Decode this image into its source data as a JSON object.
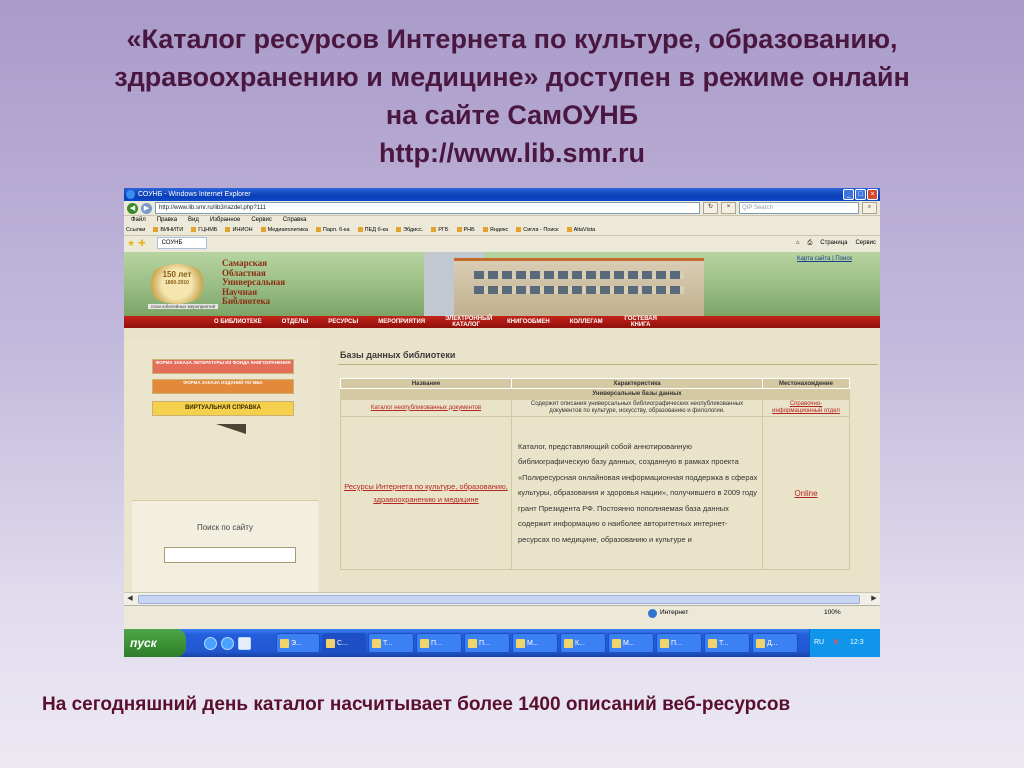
{
  "slide": {
    "title_line1": "«Каталог  ресурсов Интернета по культуре, образованию,",
    "title_line2": "здравоохранению и медицине» доступен в режиме онлайн",
    "title_line3": "на сайте СамОУНБ",
    "title_line4": "http://www.lib.smr.ru",
    "caption": "На сегодняшний день каталог насчитывает более 1400  описаний веб-ресурсов"
  },
  "browser": {
    "window_title": "СОУНБ - Windows Internet Explorer",
    "address": "http://www.lib.smr.ru/lib3/razdel.php?111",
    "search_placeholder": "QIP Search",
    "menu": [
      "Файл",
      "Правка",
      "Вид",
      "Избранное",
      "Сервис",
      "Справка"
    ],
    "links_label": "Ссылки",
    "links": [
      "ВИНИТИ",
      "ГЦНМБ",
      "ИНИОН",
      "Медиаполитика",
      "Парл. б-ка",
      "ПЕД б-ка",
      "Эбдисс.",
      "РГБ",
      "РНБ",
      "Яндекс",
      "Сигла - Поиск",
      "AltaVista"
    ],
    "tab_label": "СОУНБ",
    "tools": [
      "Страница",
      "Сервис"
    ],
    "status_zone": "Интернет",
    "zoom": "100%"
  },
  "site": {
    "top_link": "Карта сайта | Поиск",
    "anniversary": "150 лет",
    "anniversary_years": "1860-2010",
    "logo_lines": [
      "Самарская",
      "Областная",
      "Универсальная",
      "Научная",
      "Библиотека"
    ],
    "logo_sub": "план юбилейных мероприятий",
    "nav": [
      "О БИБЛИОТЕКЕ",
      "ОТДЕЛЫ",
      "РЕСУРСЫ",
      "МЕРОПРИЯТИЯ",
      "ЭЛЕКТРОННЫЙ КАТАЛОГ",
      "КНИГООБМЕН",
      "КОЛЛЕГАМ",
      "ГОСТЕВАЯ КНИГА"
    ],
    "side_buttons": [
      "ФОРМА ЗАКАЗА ЛИТЕРАТУРЫ ИЗ ФОНДА КНИГОХРАНЕНИЯ",
      "ФОРМА ЗАКАЗА ИЗДАНИЙ ПО МБА",
      "ВИРТУАЛЬНАЯ СПРАВКА"
    ],
    "search_label": "Поиск по сайту",
    "db_heading": "Базы данных библиотеки",
    "table": {
      "headers": [
        "Название",
        "Характеристика",
        "Местонахождение"
      ],
      "subheader": "Универсальные базы данных",
      "rows": [
        {
          "name": "Каталог неопубликованных документов",
          "desc": "Содержит описания универсальных библиографических неопубликованных документов по культуре, искусству, образованию и филологии.",
          "location": "Справочно-информационный отдел"
        },
        {
          "name": "Ресурсы Интернета по культуре, образованию, здравоохранению и медицине",
          "desc": "Каталог, представляющий собой аннотированную библиографическую базу данных, созданную в рамках проекта «Полиресурсная онлайновая информационная поддержка в сферах культуры, образования и здоровья нации», получившего в 2009 году грант Президента РФ. Постоянно пополняемая база данных содержит информацию о наиболее авторитетных интернет-ресурсах по медицине, образованию и культуре и",
          "location": "Online"
        }
      ]
    }
  },
  "taskbar": {
    "start": "пуск",
    "items": [
      "Э...",
      "С...",
      "Т...",
      "П...",
      "П...",
      "М...",
      "К...",
      "М...",
      "П...",
      "Т...",
      "Д..."
    ],
    "lang": "RU",
    "clock": "12:3"
  }
}
